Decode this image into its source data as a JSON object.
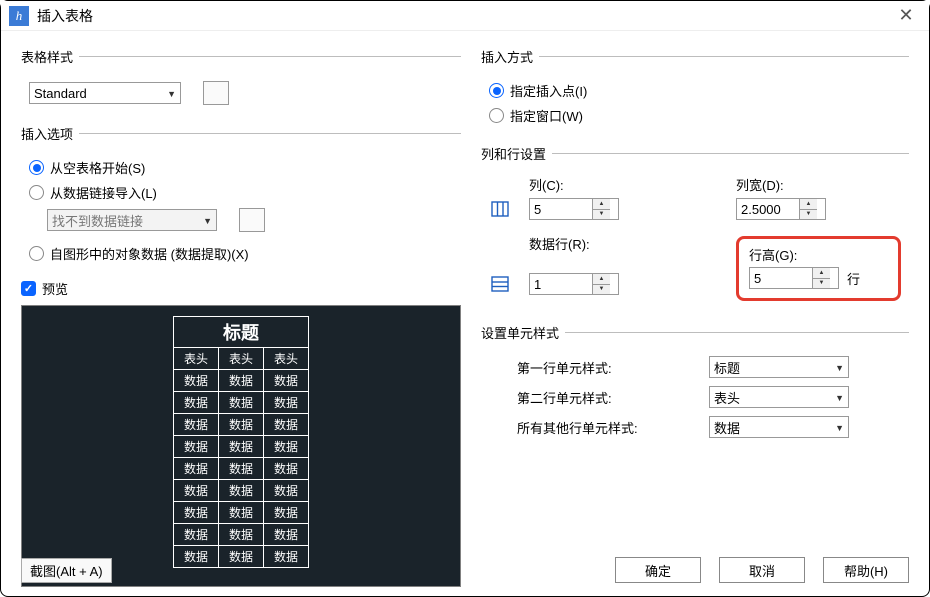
{
  "titlebar": {
    "icon_glyph": "h",
    "title": "插入表格"
  },
  "table_style": {
    "legend": "表格样式",
    "selected": "Standard"
  },
  "insert_option": {
    "legend": "插入选项",
    "r1": "从空表格开始(S)",
    "r2": "从数据链接导入(L)",
    "link_placeholder": "找不到数据链接",
    "r3": "自图形中的对象数据 (数据提取)(X)"
  },
  "preview": {
    "legend": "预览",
    "title_cell": "标题",
    "header_cell": "表头",
    "data_cell": "数据",
    "cols": 3,
    "data_rows": 9
  },
  "insert_method": {
    "legend": "插入方式",
    "r1": "指定插入点(I)",
    "r2": "指定窗口(W)"
  },
  "colrow": {
    "legend": "列和行设置",
    "col_label": "列(C):",
    "col_val": "5",
    "colw_label": "列宽(D):",
    "colw_val": "2.5000",
    "datarow_label": "数据行(R):",
    "datarow_val": "1",
    "rowh_label": "行高(G):",
    "rowh_val": "5",
    "rowh_unit": "行"
  },
  "cellstyle": {
    "legend": "设置单元样式",
    "row1_label": "第一行单元样式:",
    "row1_val": "标题",
    "row2_label": "第二行单元样式:",
    "row2_val": "表头",
    "other_label": "所有其他行单元样式:",
    "other_val": "数据"
  },
  "footer": {
    "ok": "确定",
    "cancel": "取消",
    "help": "帮助(H)",
    "screenshot_hint": "截图(Alt + A)"
  }
}
